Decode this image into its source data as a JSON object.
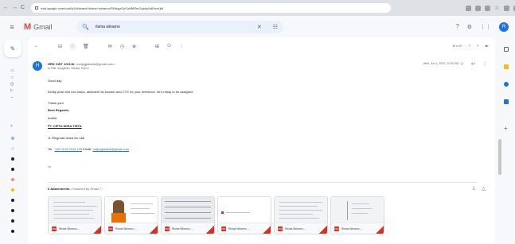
{
  "browser": {
    "url": "mail.google.com/mail/u/0/#search/risma+winarno/FMfcgzGpGxtfMRmGqbbyNdRzzKjbf",
    "back": "←",
    "forward": "→",
    "reload": "C"
  },
  "gmail": {
    "menu_glyph": "≡",
    "logo_m": "M",
    "logo_text": "Gmail",
    "search_query": "risma winarno",
    "search_glyph": "🔍",
    "clear_glyph": "✕",
    "filter_glyph": "☷",
    "help_glyph": "?",
    "settings_glyph": "⚙",
    "apps_glyph": "⋮⋮",
    "account_initial": "R"
  },
  "rail": {
    "compose_glyph": "✎"
  },
  "toolbar": {
    "back_glyph": "←",
    "archive_glyph": "⊟",
    "spam_glyph": "ⓘ",
    "delete_glyph": "🗑",
    "mail_glyph": "✉",
    "snooze_glyph": "◷",
    "task_glyph": "⊕",
    "move_glyph": "⊞",
    "label_glyph": "⬭",
    "more_glyph": "⋮",
    "count": "39 of 57",
    "prev_glyph": "‹",
    "next_glyph": "›",
    "pen_glyph": "✒"
  },
  "message": {
    "sender_initial": "H",
    "sender_name": "HRD CWT JOGJA",
    "sender_email": "<cwtjogjakarta@gmail.com>",
    "to": "to Fifie, Anugerah, Nanda, Tomi ▾",
    "date": "Wed, Jun 1, 2022, 12:50 PM",
    "star_glyph": "☆",
    "reply_glyph": "↩",
    "more_glyph": "⋮",
    "greeting": "Good day,",
    "line1": "Kindly push him into mapc, attached his booster and CTC for your reference. he's ready to be assigned",
    "thanks": "Thank you!",
    "regards": "Best Regards,",
    "name": "Aurilia",
    "company": "PT. CIPTA WIRA TIRTA",
    "address": "Jl. Ringroad Utara No 166",
    "tel_label": "Tel :",
    "tel": "+62 0122 0100 125",
    "email_label": "Email:",
    "email": "cwtjogjakarta@gmail.com",
    "ellipsis": "•••"
  },
  "attachments": {
    "label": "6 Attachments",
    "scanned": "• Scanned by Gmail ⓘ",
    "download_all_glyph": "⤓",
    "drive_glyph": "△",
    "items": [
      {
        "name": "Risma Winarno -..."
      },
      {
        "name": "Risma Winarno -..."
      },
      {
        "name": "Risma Winarno -..."
      },
      {
        "name": "Risma Winarno -..."
      },
      {
        "name": "Risma Winarno -..."
      },
      {
        "name": "Risma Winarno -..."
      }
    ]
  },
  "colors": {
    "accent": "#1a73e8",
    "pdf": "#d93025",
    "gmail_red": "#ea4335"
  }
}
